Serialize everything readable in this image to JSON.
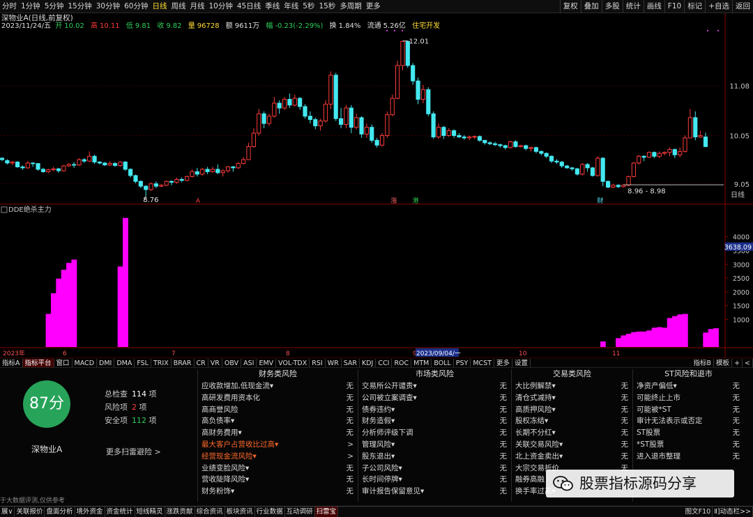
{
  "topbar": {
    "periods": [
      "分时",
      "1分钟",
      "5分钟",
      "15分钟",
      "30分钟",
      "60分钟",
      "日线",
      "周线",
      "月线",
      "10分钟",
      "45日线",
      "季线",
      "年线",
      "5秒",
      "15秒",
      "多周期",
      "更多"
    ],
    "active": "日线",
    "right": [
      "复权",
      "叠加",
      "多股",
      "统计",
      "画线",
      "F10",
      "标记",
      "+自选",
      "返回"
    ]
  },
  "stock": {
    "name": "深物业A",
    "title_suffix": "(日线,前复权)",
    "date": "2023/11/24/五",
    "open_label": "开",
    "open": "10.02",
    "high_label": "高",
    "high": "10.11",
    "low_label": "低",
    "low": "9.81",
    "close_label": "收",
    "close": "9.82",
    "vol_label": "量",
    "vol": "96728",
    "amt_label": "额",
    "amt": "9611万",
    "chg_label": "幅",
    "chg": "-0.23(-2.29%)",
    "turn_label": "换",
    "turn": "1.84%",
    "float_label": "流通",
    "float": "5.26亿",
    "sector": "住宅开发"
  },
  "chart_data": {
    "type": "candlestick",
    "price_axis": [
      "11.08",
      "10.05",
      "9.05"
    ],
    "annotations": [
      {
        "text": "12.01"
      },
      {
        "text": "8.76"
      },
      {
        "text": "8.96 - 8.98"
      }
    ],
    "markers": [
      "A",
      "涨",
      "港",
      "财"
    ],
    "period_label": "日线",
    "candles": [
      [
        9.58,
        9.55,
        9.6,
        9.52
      ],
      [
        9.53,
        9.48,
        9.56,
        9.45
      ],
      [
        9.48,
        9.5,
        9.52,
        9.44
      ],
      [
        9.5,
        9.4,
        9.52,
        9.38
      ],
      [
        9.4,
        9.38,
        9.43,
        9.34
      ],
      [
        9.38,
        9.48,
        9.52,
        9.36
      ],
      [
        9.48,
        9.47,
        9.5,
        9.4
      ],
      [
        9.47,
        9.35,
        9.48,
        9.32
      ],
      [
        9.35,
        9.3,
        9.38,
        9.28
      ],
      [
        9.3,
        9.34,
        9.36,
        9.27
      ],
      [
        9.34,
        9.36,
        9.4,
        9.31
      ],
      [
        9.36,
        9.32,
        9.38,
        9.28
      ],
      [
        9.32,
        9.42,
        9.44,
        9.3
      ],
      [
        9.42,
        9.45,
        9.48,
        9.4
      ],
      [
        9.45,
        9.44,
        9.5,
        9.38
      ],
      [
        9.44,
        9.55,
        9.58,
        9.42
      ],
      [
        9.55,
        9.52,
        9.58,
        9.48
      ],
      [
        9.52,
        9.62,
        9.72,
        9.5
      ],
      [
        9.62,
        9.5,
        9.65,
        9.46
      ],
      [
        9.5,
        9.48,
        9.52,
        9.45
      ],
      [
        9.48,
        9.44,
        9.5,
        9.42
      ],
      [
        9.44,
        9.47,
        9.52,
        9.42
      ],
      [
        9.47,
        9.43,
        9.5,
        9.4
      ],
      [
        9.43,
        9.5,
        9.52,
        9.4
      ],
      [
        9.5,
        9.35,
        9.52,
        9.32
      ],
      [
        9.35,
        9.22,
        9.37,
        9.18
      ],
      [
        9.22,
        9.1,
        9.24,
        9.06
      ],
      [
        9.1,
        9.0,
        9.12,
        8.96
      ],
      [
        9.0,
        8.93,
        9.02,
        8.8
      ],
      [
        8.93,
        9.05,
        9.08,
        8.9
      ],
      [
        9.05,
        9.0,
        9.1,
        8.96
      ],
      [
        9.0,
        9.02,
        9.04,
        8.98
      ],
      [
        9.02,
        9.1,
        9.12,
        9.0
      ],
      [
        9.1,
        9.08,
        9.12,
        9.02
      ],
      [
        9.08,
        9.14,
        9.18,
        9.05
      ],
      [
        9.14,
        9.12,
        9.18,
        9.08
      ],
      [
        9.12,
        9.2,
        9.22,
        9.1
      ],
      [
        9.2,
        9.3,
        9.35,
        9.18
      ],
      [
        9.3,
        9.25,
        9.38,
        9.2
      ],
      [
        9.25,
        9.35,
        9.38,
        9.22
      ],
      [
        9.35,
        9.3,
        9.4,
        9.25
      ],
      [
        9.3,
        9.35,
        9.4,
        9.28
      ],
      [
        9.35,
        9.28,
        9.45,
        9.25
      ],
      [
        9.28,
        9.32,
        9.35,
        9.2
      ],
      [
        9.32,
        9.4,
        9.42,
        9.28
      ],
      [
        9.4,
        9.38,
        9.42,
        9.3
      ],
      [
        9.38,
        9.47,
        9.5,
        9.36
      ],
      [
        9.47,
        9.55,
        9.6,
        9.45
      ],
      [
        9.55,
        9.82,
        9.9,
        9.55
      ],
      [
        9.82,
        10.1,
        10.2,
        9.8
      ],
      [
        10.1,
        10.5,
        10.6,
        10.05
      ],
      [
        10.5,
        10.3,
        10.55,
        10.2
      ],
      [
        10.3,
        10.45,
        10.5,
        10.25
      ],
      [
        10.45,
        10.72,
        10.85,
        10.42
      ],
      [
        10.72,
        10.62,
        10.78,
        10.5
      ],
      [
        10.62,
        10.8,
        10.85,
        10.58
      ],
      [
        10.8,
        10.68,
        10.92,
        10.62
      ],
      [
        10.68,
        10.82,
        10.9,
        10.65
      ],
      [
        10.82,
        10.65,
        10.85,
        10.58
      ],
      [
        10.65,
        10.45,
        10.7,
        10.4
      ],
      [
        10.45,
        10.38,
        10.55,
        10.3
      ],
      [
        10.38,
        10.25,
        10.42,
        10.18
      ],
      [
        10.25,
        10.35,
        10.4,
        10.15
      ],
      [
        10.35,
        10.7,
        10.78,
        10.32
      ],
      [
        10.7,
        11.3,
        11.38,
        10.6
      ],
      [
        11.3,
        10.4,
        11.35,
        10.35
      ],
      [
        10.4,
        10.28,
        10.62,
        10.2
      ],
      [
        10.28,
        10.62,
        10.68,
        10.2
      ],
      [
        10.62,
        10.22,
        10.68,
        10.1
      ],
      [
        10.22,
        10.42,
        10.5,
        10.18
      ],
      [
        10.42,
        10.08,
        10.45,
        10.0
      ],
      [
        10.08,
        10.22,
        10.3,
        10.0
      ],
      [
        10.22,
        9.95,
        10.28,
        9.9
      ],
      [
        9.95,
        9.85,
        10.0,
        9.8
      ],
      [
        9.85,
        10.05,
        10.1,
        9.82
      ],
      [
        10.05,
        10.48,
        10.55,
        10.0
      ],
      [
        10.48,
        10.82,
        10.9,
        10.45
      ],
      [
        10.82,
        11.5,
        11.6,
        10.8
      ],
      [
        11.5,
        12.0,
        12.01,
        11.4
      ],
      [
        12.0,
        11.5,
        12.01,
        11.45
      ],
      [
        11.5,
        11.18,
        11.55,
        11.1
      ],
      [
        11.18,
        10.8,
        11.25,
        10.7
      ],
      [
        10.8,
        11.0,
        11.1,
        10.72
      ],
      [
        11.0,
        10.5,
        11.05,
        10.45
      ],
      [
        10.5,
        10.02,
        10.55,
        9.98
      ],
      [
        10.02,
        10.22,
        10.3,
        9.98
      ],
      [
        10.22,
        10.05,
        10.25,
        9.98
      ],
      [
        10.05,
        10.15,
        10.2,
        10.02
      ],
      [
        10.15,
        10.05,
        10.18,
        10.0
      ],
      [
        10.05,
        10.02,
        10.1,
        10.0
      ],
      [
        10.02,
        10.0,
        10.06,
        9.96
      ],
      [
        10.0,
        10.02,
        10.05,
        9.95
      ],
      [
        10.02,
        10.03,
        10.05,
        9.98
      ],
      [
        10.03,
        9.95,
        10.05,
        9.92
      ],
      [
        9.95,
        9.9,
        9.96,
        9.86
      ],
      [
        9.9,
        9.88,
        9.93,
        9.85
      ],
      [
        9.88,
        9.86,
        9.92,
        9.83
      ],
      [
        9.86,
        9.84,
        9.88,
        9.8
      ],
      [
        9.84,
        9.8,
        9.86,
        9.76
      ],
      [
        9.8,
        9.92,
        9.94,
        9.78
      ],
      [
        9.92,
        9.82,
        9.95,
        9.8
      ],
      [
        9.82,
        9.84,
        9.86,
        9.8
      ],
      [
        9.84,
        9.78,
        9.86,
        9.74
      ],
      [
        9.78,
        9.8,
        9.82,
        9.72
      ],
      [
        9.8,
        9.72,
        9.82,
        9.68
      ],
      [
        9.72,
        9.68,
        9.74,
        9.64
      ],
      [
        9.68,
        9.62,
        9.7,
        9.58
      ],
      [
        9.62,
        9.52,
        9.64,
        9.48
      ],
      [
        9.52,
        9.5,
        9.56,
        9.46
      ],
      [
        9.5,
        9.42,
        9.52,
        9.38
      ],
      [
        9.42,
        9.38,
        9.44,
        9.36
      ],
      [
        9.38,
        9.36,
        9.4,
        9.32
      ],
      [
        9.36,
        9.25,
        9.38,
        9.22
      ],
      [
        9.25,
        9.45,
        9.48,
        9.22
      ],
      [
        9.45,
        9.38,
        9.48,
        9.3
      ],
      [
        9.38,
        9.22,
        9.4,
        9.2
      ],
      [
        9.22,
        9.58,
        9.62,
        9.2
      ],
      [
        9.58,
        9.1,
        9.6,
        9.0
      ],
      [
        9.1,
        8.98,
        9.12,
        8.96
      ],
      [
        8.98,
        9.02,
        9.05,
        8.96
      ],
      [
        9.02,
        8.99,
        9.04,
        8.96
      ],
      [
        8.99,
        9.02,
        9.04,
        8.97
      ],
      [
        9.02,
        9.2,
        9.22,
        9.0
      ],
      [
        9.2,
        9.48,
        9.5,
        9.18
      ],
      [
        9.48,
        9.62,
        9.65,
        9.45
      ],
      [
        9.62,
        9.6,
        9.64,
        9.52
      ],
      [
        9.6,
        9.7,
        9.72,
        9.58
      ],
      [
        9.7,
        9.62,
        9.72,
        9.58
      ],
      [
        9.62,
        9.68,
        9.72,
        9.58
      ],
      [
        9.68,
        9.7,
        9.72,
        9.64
      ],
      [
        9.7,
        9.76,
        9.8,
        9.62
      ],
      [
        9.76,
        9.65,
        9.78,
        9.58
      ],
      [
        9.65,
        9.72,
        9.8,
        9.6
      ],
      [
        9.72,
        10.0,
        10.05,
        9.7
      ],
      [
        10.0,
        10.42,
        10.6,
        10.0
      ],
      [
        10.42,
        10.02,
        10.55,
        9.95
      ],
      [
        10.02,
        10.05,
        10.15,
        10.0
      ],
      [
        10.02,
        9.82,
        10.11,
        9.81
      ]
    ],
    "sub": {
      "title": "DDE绝杀主力",
      "y_ticks": [
        "4000",
        "3500",
        "3000",
        "2500",
        "2000",
        "1500",
        "1000"
      ],
      "current": "3638.09",
      "bars": [
        [
          9,
          1200
        ],
        [
          10,
          1950
        ],
        [
          11,
          2480
        ],
        [
          12,
          2800
        ],
        [
          13,
          3050
        ],
        [
          14,
          3170
        ],
        [
          23,
          2920
        ],
        [
          24,
          4680
        ],
        [
          117,
          200
        ],
        [
          120,
          320
        ],
        [
          121,
          420
        ],
        [
          122,
          480
        ],
        [
          123,
          540
        ],
        [
          124,
          560
        ],
        [
          125,
          560
        ],
        [
          126,
          600
        ],
        [
          127,
          700
        ],
        [
          128,
          720
        ],
        [
          129,
          700
        ],
        [
          130,
          1050
        ],
        [
          131,
          1120
        ],
        [
          132,
          1180
        ],
        [
          133,
          1200
        ],
        [
          137,
          520
        ],
        [
          138,
          650
        ],
        [
          139,
          680
        ]
      ]
    },
    "x_axis": [
      "2023年",
      "6",
      "7",
      "8",
      "9",
      "10",
      "11"
    ],
    "cursor_date": "2023/09/04/一"
  },
  "indicator_tabs": [
    "指标A",
    "指标平台",
    "窗口",
    "MACD",
    "DMI",
    "DMA",
    "FSL",
    "TRIX",
    "BRAR",
    "CR",
    "VR",
    "OBV",
    "ASI",
    "EMV",
    "VOL-TDX",
    "RSI",
    "WR",
    "SAR",
    "KDJ",
    "CCI",
    "ROC",
    "MTM",
    "BOLL",
    "PSY",
    "MCST",
    "更多",
    "设置"
  ],
  "indicator_right": [
    "指标B",
    "模板",
    "+",
    "<"
  ],
  "risk": {
    "score": "87分",
    "name": "深物业A",
    "total_label": "总检查",
    "total": "114",
    "total_unit": "项",
    "risk_label": "风险项",
    "risk_count": "2",
    "risk_unit": "项",
    "safe_label": "安全项",
    "safe_count": "112",
    "safe_unit": "项",
    "more": "更多扫雷避险 >",
    "disclaimer": "于大数据评测,仅供参考",
    "cols": [
      {
        "title": "财务类风险",
        "items": [
          {
            "label": "应收款增加,低现金流▾",
            "value": "无"
          },
          {
            "label": "高研发费用资本化",
            "value": "无"
          },
          {
            "label": "高商誉风险",
            "value": "无"
          },
          {
            "label": "高负债率▾",
            "value": "无"
          },
          {
            "label": "高财务费用▾",
            "value": "无"
          },
          {
            "label": "最大客户占营收比过高▾",
            "value": ">",
            "warn": true
          },
          {
            "label": "经营现金流风险▾",
            "value": ">",
            "warn": true
          },
          {
            "label": "业绩变脸风险▾",
            "value": "无"
          },
          {
            "label": "营收陡降风险▾",
            "value": "无"
          },
          {
            "label": "财务粉饰▾",
            "value": "无"
          }
        ]
      },
      {
        "title": "市场类风险",
        "items": [
          {
            "label": "交易所公开谴责▾",
            "value": "无"
          },
          {
            "label": "公司被立案调查▾",
            "value": "无"
          },
          {
            "label": "债券违约▾",
            "value": "无"
          },
          {
            "label": "财务造假▾",
            "value": "无"
          },
          {
            "label": "分析师评级下调",
            "value": "无"
          },
          {
            "label": "管理风险▾",
            "value": "无"
          },
          {
            "label": "股东退出▾",
            "value": "无"
          },
          {
            "label": "子公司风险▾",
            "value": "无"
          },
          {
            "label": "长时间停牌▾",
            "value": "无"
          },
          {
            "label": "审计报告保留意见▾",
            "value": "无"
          }
        ]
      },
      {
        "title": "交易类风险",
        "items": [
          {
            "label": "大比例解禁▾",
            "value": "无"
          },
          {
            "label": "清仓式减持▾",
            "value": "无"
          },
          {
            "label": "高质押风险▾",
            "value": "无"
          },
          {
            "label": "股权冻结▾",
            "value": "无"
          },
          {
            "label": "长期不分红▾",
            "value": "无"
          },
          {
            "label": "关联交易风险▾",
            "value": "无"
          },
          {
            "label": "北上资金卖出▾",
            "value": "无"
          },
          {
            "label": "大宗交易折价",
            "value": "无"
          },
          {
            "label": "融券高融",
            "value": ""
          },
          {
            "label": "换手率过高▾",
            "value": ""
          }
        ]
      },
      {
        "title": "ST风险和退市",
        "items": [
          {
            "label": "净资产偏低▾",
            "value": "无"
          },
          {
            "label": "可能终止上市",
            "value": "无"
          },
          {
            "label": "可能被*ST",
            "value": "无"
          },
          {
            "label": "审计无法表示或否定",
            "value": "无"
          },
          {
            "label": "ST股票",
            "value": "无"
          },
          {
            "label": "*ST股票",
            "value": "无"
          },
          {
            "label": "进入退市整理",
            "value": "无"
          }
        ]
      }
    ]
  },
  "watermark": "股票指标源码分享",
  "bottom_tabs": [
    "展∨",
    "关联报价",
    "盘面分析",
    "境外资金",
    "资金统计",
    "短线精灵",
    "涨跌贡献",
    "综合资讯",
    "板块资讯",
    "行业数据",
    "互动调研",
    "扫雷宝"
  ],
  "bottom_active": "扫雷宝",
  "bottom_right": [
    "图文F10",
    "Ⅱ]动态栏>>"
  ],
  "colors": {
    "up": "#ff3b3b",
    "down": "#44e8f0",
    "dde": "#ff00ff",
    "score_bg": "#27a35a"
  }
}
